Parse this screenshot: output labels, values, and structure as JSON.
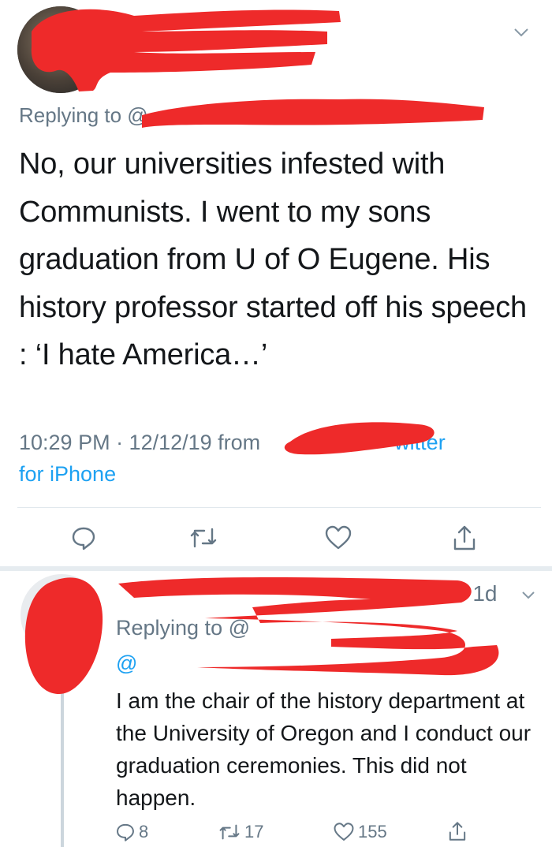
{
  "main_tweet": {
    "replying_prefix": "Replying to @",
    "text": "No, our universities infested with Communists. I went to my sons graduation from  U of O Eugene. His history professor started off his speech : ‘I hate America…’",
    "time": "10:29 PM · 12/12/19 from",
    "client_suffix": "witter",
    "client_line2": "for iPhone",
    "actions": {
      "reply_icon": "reply-icon",
      "retweet_icon": "retweet-icon",
      "like_icon": "heart-icon",
      "share_icon": "share-icon"
    }
  },
  "reply_tweet": {
    "time": "·1d",
    "replying_prefix": "Replying to @",
    "handle_at": "@",
    "text": "I am the chair of the history department at the University of Oregon and I conduct our graduation ceremonies. This did not happen.",
    "stats": {
      "replies": "8",
      "retweets": "17",
      "likes": "155"
    }
  },
  "colors": {
    "link_blue": "#1da1f2",
    "muted_gray": "#657786",
    "redaction_red": "#ee2a2a",
    "divider": "#e1e8ed"
  }
}
